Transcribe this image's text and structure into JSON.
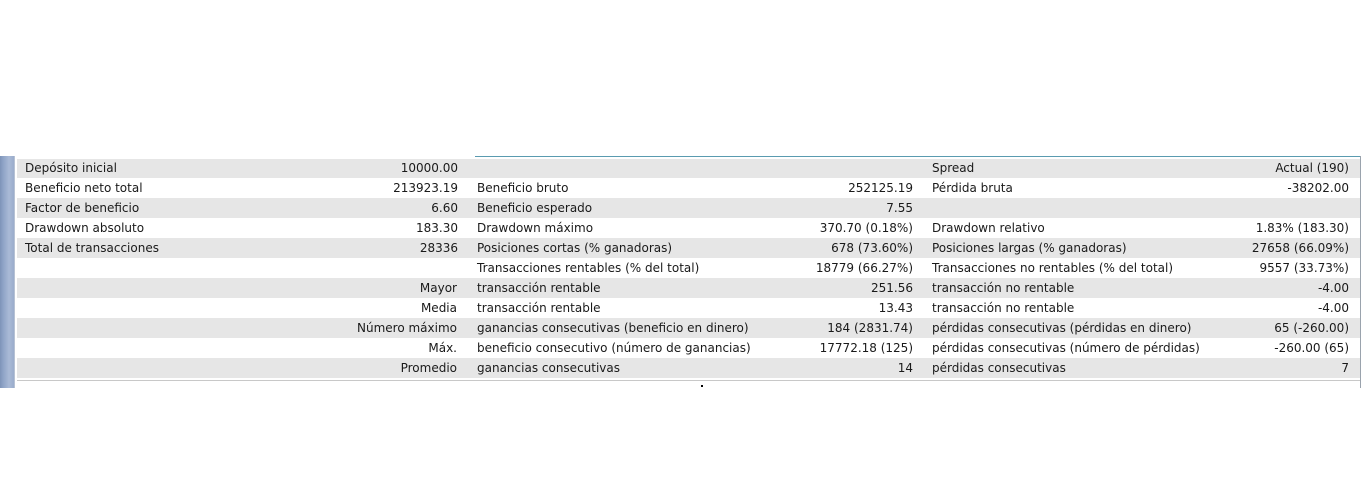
{
  "report": {
    "rows": [
      {
        "shade": true,
        "c1": {
          "label": "Depósito inicial",
          "value": "10000.00"
        },
        "c2": {
          "label": "",
          "value": ""
        },
        "c3": {
          "label": "Spread",
          "value": "Actual (190)"
        }
      },
      {
        "shade": false,
        "c1": {
          "label": "Beneficio neto total",
          "value": "213923.19"
        },
        "c2": {
          "label": "Beneficio bruto",
          "value": "252125.19"
        },
        "c3": {
          "label": "Pérdida bruta",
          "value": "-38202.00"
        }
      },
      {
        "shade": true,
        "c1": {
          "label": "Factor de beneficio",
          "value": "6.60"
        },
        "c2": {
          "label": "Beneficio esperado",
          "value": "7.55"
        },
        "c3": {
          "label": "",
          "value": ""
        }
      },
      {
        "shade": false,
        "c1": {
          "label": "Drawdown absoluto",
          "value": "183.30"
        },
        "c2": {
          "label": "Drawdown máximo",
          "value": "370.70 (0.18%)"
        },
        "c3": {
          "label": "Drawdown relativo",
          "value": "1.83% (183.30)"
        }
      },
      {
        "shade": true,
        "c1": {
          "label": "Total de transacciones",
          "value": "28336"
        },
        "c2": {
          "label": "Posiciones cortas (% ganadoras)",
          "value": "678 (73.60%)"
        },
        "c3": {
          "label": "Posiciones largas (% ganadoras)",
          "value": "27658 (66.09%)"
        }
      },
      {
        "shade": false,
        "c1": {
          "label": "",
          "right_label": ""
        },
        "c2": {
          "label": "Transacciones rentables (% del total)",
          "value": "18779 (66.27%)"
        },
        "c3": {
          "label": "Transacciones no rentables (% del total)",
          "value": "9557 (33.73%)"
        }
      },
      {
        "shade": true,
        "c1": {
          "label": "",
          "right_label": "Mayor"
        },
        "c2": {
          "label": "transacción rentable",
          "value": "251.56"
        },
        "c3": {
          "label": "transacción no rentable",
          "value": "-4.00"
        }
      },
      {
        "shade": false,
        "c1": {
          "label": "",
          "right_label": "Media"
        },
        "c2": {
          "label": "transacción rentable",
          "value": "13.43"
        },
        "c3": {
          "label": "transacción no rentable",
          "value": "-4.00"
        }
      },
      {
        "shade": true,
        "c1": {
          "label": "",
          "right_label": "Número máximo"
        },
        "c2": {
          "label": "ganancias consecutivas (beneficio en dinero)",
          "value": "184 (2831.74)"
        },
        "c3": {
          "label": "pérdidas consecutivas (pérdidas en dinero)",
          "value": "65 (-260.00)"
        }
      },
      {
        "shade": false,
        "c1": {
          "label": "",
          "right_label": "Máx."
        },
        "c2": {
          "label": "beneficio consecutivo (número de ganancias)",
          "value": "17772.18 (125)"
        },
        "c3": {
          "label": "pérdidas consecutivas (número de pérdidas)",
          "value": "-260.00 (65)"
        }
      },
      {
        "shade": true,
        "c1": {
          "label": "",
          "right_label": "Promedio"
        },
        "c2": {
          "label": "ganancias consecutivas",
          "value": "14"
        },
        "c3": {
          "label": "pérdidas consecutivas",
          "value": "7"
        }
      }
    ]
  },
  "colors": {
    "row_shade": "#e6e6e6",
    "row_plain": "#ffffff",
    "side_bar": "#9aaccc",
    "accent_line": "#5a9bb0"
  }
}
